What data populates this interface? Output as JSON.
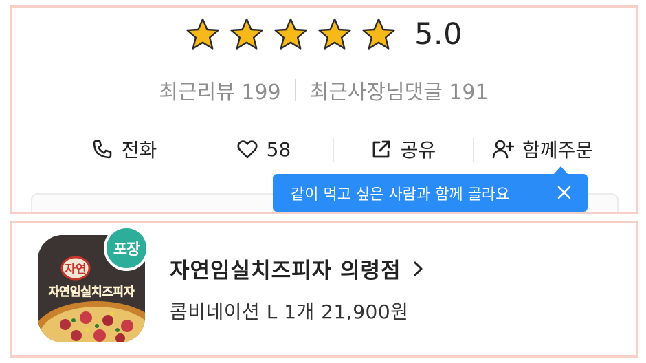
{
  "rating": {
    "stars_filled": 5,
    "stars_total": 5,
    "value": "5.0",
    "star_color": "#f7b91a"
  },
  "counts": {
    "recent_reviews": "최근리뷰 199",
    "owner_replies": "최근사장님댓글 191"
  },
  "actions": {
    "call": {
      "icon": "phone-icon",
      "label": "전화"
    },
    "like": {
      "icon": "heart-icon",
      "label": "58"
    },
    "share": {
      "icon": "share-icon",
      "label": "공유"
    },
    "group_order": {
      "icon": "add-user-icon",
      "label": "함께주문"
    }
  },
  "tooltip": {
    "text": "같이 먹고 싶은 사람과 함께 골라요",
    "close_icon": "close-icon",
    "color": "#2a8cf7"
  },
  "store": {
    "badge": "포장",
    "badge_color": "#2cae9a",
    "name": "자연임실치즈피자 의령점",
    "order_summary": "콤비네이션 L 1개 21,900원",
    "thumbnail_text_top": "자연",
    "thumbnail_text_brand": "자연임실치즈피자"
  }
}
